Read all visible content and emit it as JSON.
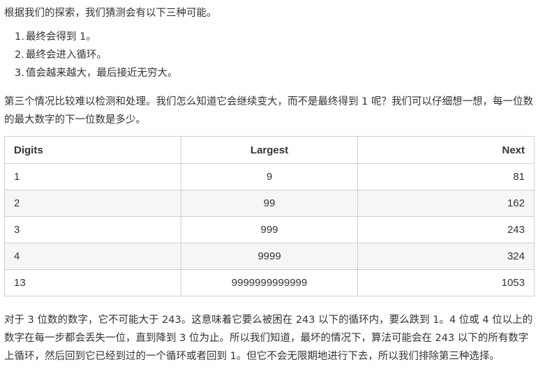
{
  "intro": "根据我们的探索，我们猜测会有以下三种可能。",
  "list": [
    {
      "num": "1.",
      "text": "最终会得到 1。"
    },
    {
      "num": "2.",
      "text": "最终会进入循环。"
    },
    {
      "num": "3.",
      "text": "值会越来越大，最后接近无穷大。"
    }
  ],
  "para2": "第三个情况比较难以检测和处理。我们怎么知道它会继续变大，而不是最终得到 1 呢？我们可以仔细想一想，每一位数的最大数字的下一位数是多少。",
  "table": {
    "headers": [
      "Digits",
      "Largest",
      "Next"
    ],
    "rows": [
      [
        "1",
        "9",
        "81"
      ],
      [
        "2",
        "99",
        "162"
      ],
      [
        "3",
        "999",
        "243"
      ],
      [
        "4",
        "9999",
        "324"
      ],
      [
        "13",
        "9999999999999",
        "1053"
      ]
    ]
  },
  "para3": "对于 3 位数的数字，它不可能大于 243。这意味着它要么被困在 243 以下的循环内，要么跌到 1。4 位或 4 位以上的数字在每一步都会丢失一位，直到降到 3 位为止。所以我们知道，最坏的情况下，算法可能会在 243 以下的所有数字上循环，然后回到它已经到过的一个循环或者回到 1。但它不会无限期地进行下去，所以我们排除第三种选择。"
}
